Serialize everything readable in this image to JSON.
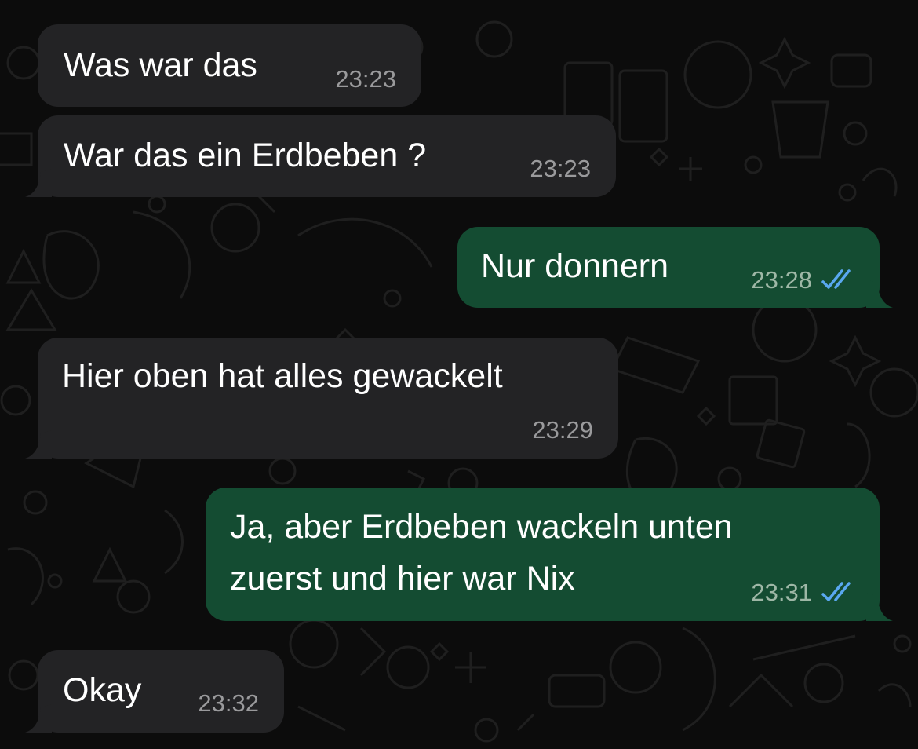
{
  "colors": {
    "incoming_bubble": "#232325",
    "outgoing_bubble": "#144c32",
    "background": "#0c0c0c",
    "read_ticks": "#5aa8f0"
  },
  "messages": [
    {
      "direction": "incoming",
      "text": "Was war das",
      "time": "23:23"
    },
    {
      "direction": "incoming",
      "text": "War das ein Erdbeben ?",
      "time": "23:23"
    },
    {
      "direction": "outgoing",
      "text": "Nur donnern",
      "time": "23:28",
      "status_icon": "double-check-read-icon"
    },
    {
      "direction": "incoming",
      "text": "Hier oben hat alles gewackelt",
      "time": "23:29"
    },
    {
      "direction": "outgoing",
      "text_line1": "Ja, aber Erdbeben wackeln unten",
      "text_line2": "zuerst und hier war Nix",
      "time": "23:31",
      "status_icon": "double-check-read-icon"
    },
    {
      "direction": "incoming",
      "text": "Okay",
      "time": "23:32"
    }
  ]
}
